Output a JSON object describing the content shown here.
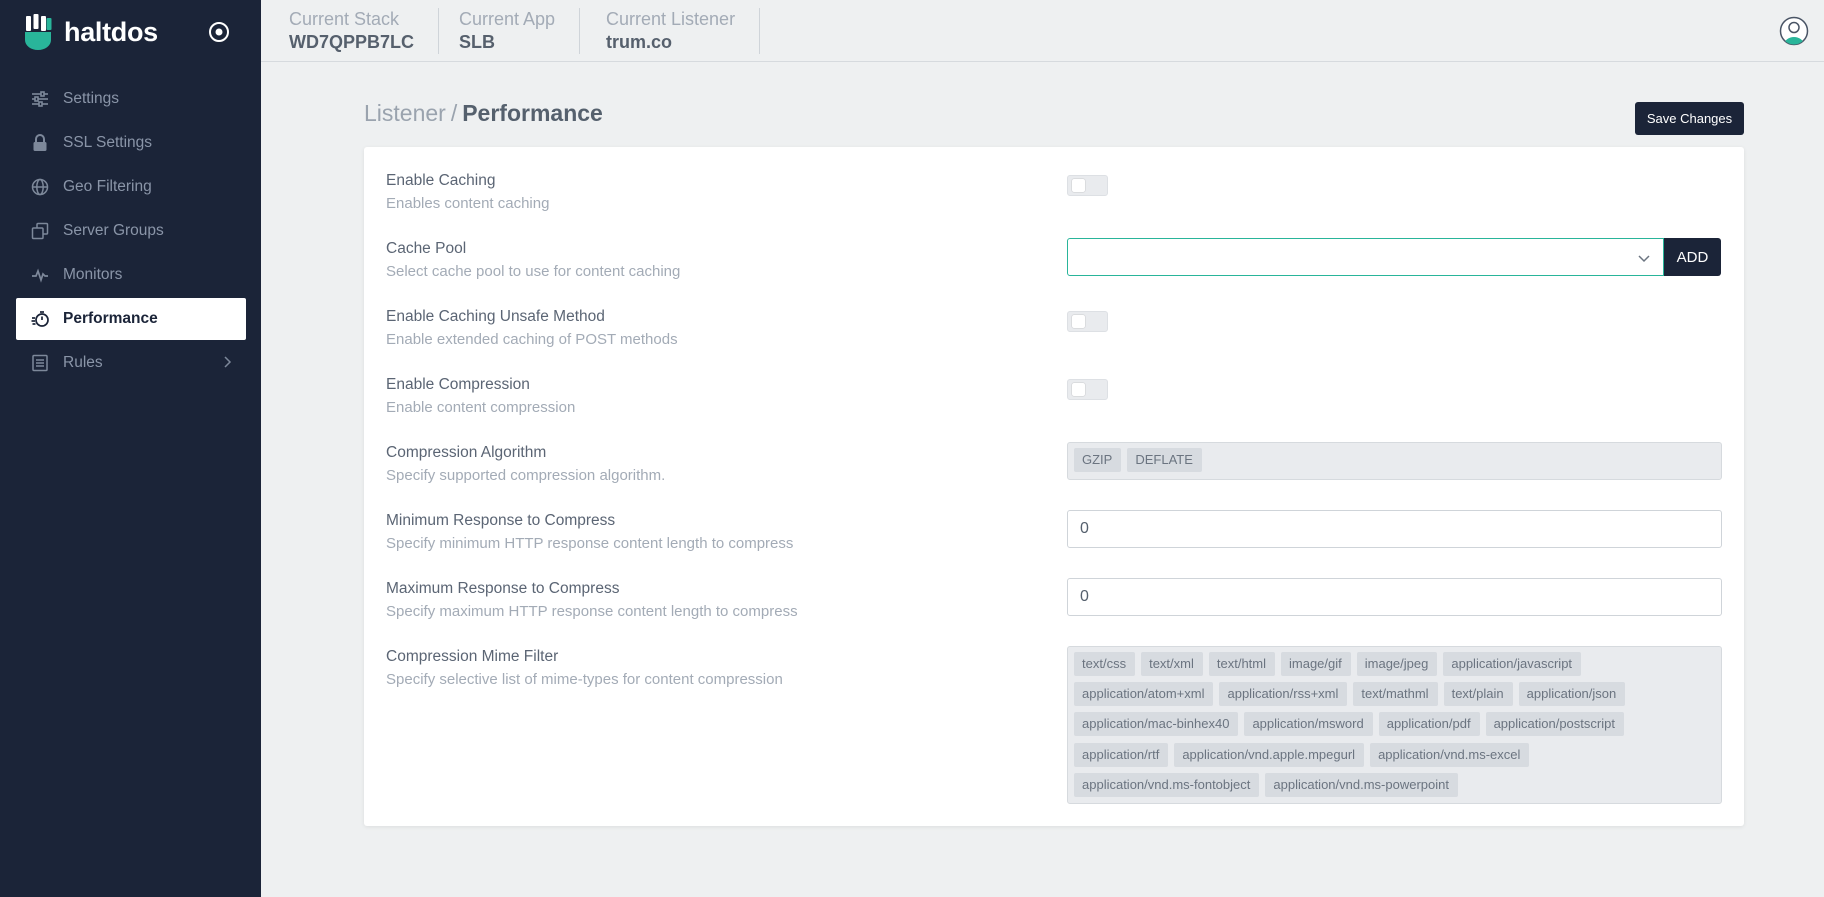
{
  "brand": {
    "name": "haltdos"
  },
  "sidebar": {
    "items": [
      {
        "label": "Settings",
        "icon": "sliders-icon"
      },
      {
        "label": "SSL Settings",
        "icon": "lock-icon"
      },
      {
        "label": "Geo Filtering",
        "icon": "globe-icon"
      },
      {
        "label": "Server Groups",
        "icon": "server-groups-icon"
      },
      {
        "label": "Monitors",
        "icon": "pulse-icon"
      },
      {
        "label": "Performance",
        "icon": "stopwatch-icon",
        "active": true
      },
      {
        "label": "Rules",
        "icon": "list-icon",
        "expandable": true
      }
    ]
  },
  "topbar": {
    "stack": {
      "label": "Current Stack",
      "value": "WD7QPPB7LC"
    },
    "app": {
      "label": "Current App",
      "value": "SLB"
    },
    "listener": {
      "label": "Current Listener",
      "value": "trum.co"
    }
  },
  "page": {
    "breadcrumb_parent": "Listener",
    "breadcrumb_separator": "/",
    "title": "Performance",
    "save_label": "Save Changes"
  },
  "settings": {
    "enable_caching": {
      "title": "Enable Caching",
      "desc": "Enables content caching",
      "value": false
    },
    "cache_pool": {
      "title": "Cache Pool",
      "desc": "Select cache pool to use for content caching",
      "value": "",
      "add_label": "ADD"
    },
    "caching_unsafe": {
      "title": "Enable Caching Unsafe Method",
      "desc": "Enable extended caching of POST methods",
      "value": false
    },
    "compression": {
      "title": "Enable Compression",
      "desc": "Enable content compression",
      "value": false
    },
    "algorithm": {
      "title": "Compression Algorithm",
      "desc": "Specify supported compression algorithm.",
      "tags": [
        "GZIP",
        "DEFLATE"
      ]
    },
    "min_response": {
      "title": "Minimum Response to Compress",
      "desc": "Specify minimum HTTP response content length to compress",
      "value": "0"
    },
    "max_response": {
      "title": "Maximum Response to Compress",
      "desc": "Specify maximum HTTP response content length to compress",
      "value": "0"
    },
    "mime_filter": {
      "title": "Compression Mime Filter",
      "desc": "Specify selective list of mime-types for content compression",
      "tags": [
        "text/css",
        "text/xml",
        "text/html",
        "image/gif",
        "image/jpeg",
        "application/javascript",
        "application/atom+xml",
        "application/rss+xml",
        "text/mathml",
        "text/plain",
        "application/json",
        "application/mac-binhex40",
        "application/msword",
        "application/pdf",
        "application/postscript",
        "application/rtf",
        "application/vnd.apple.mpegurl",
        "application/vnd.ms-excel",
        "application/vnd.ms-fontobject",
        "application/vnd.ms-powerpoint"
      ]
    }
  },
  "colors": {
    "sidebar_bg": "#1b2438",
    "accent": "#29b59a",
    "page_bg": "#eef0f1"
  }
}
